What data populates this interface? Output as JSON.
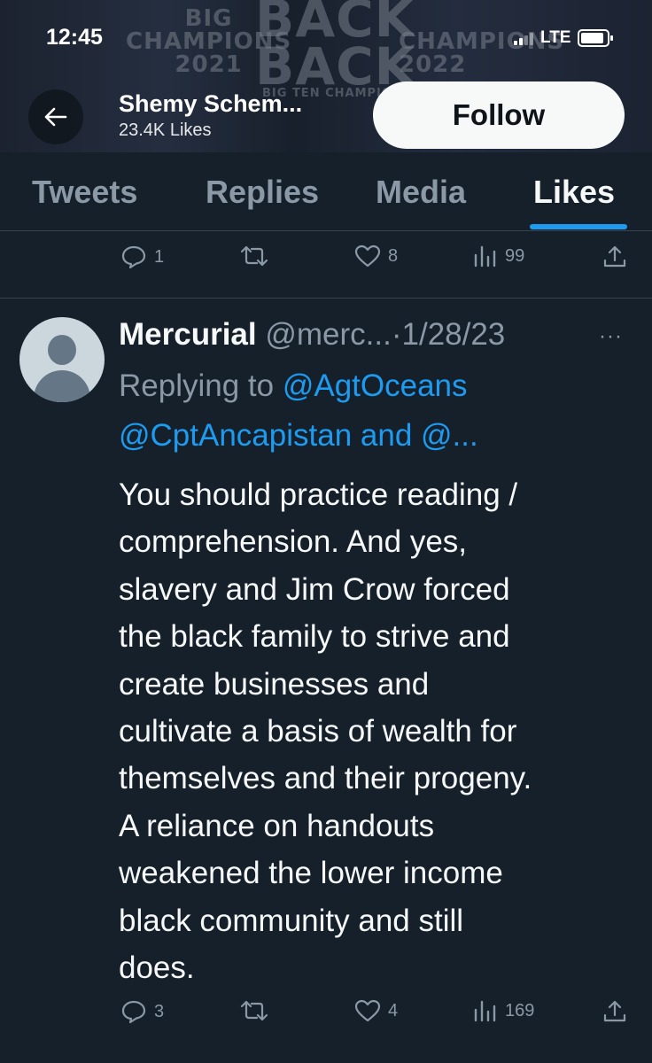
{
  "status": {
    "time": "12:45",
    "network": "LTE"
  },
  "header": {
    "banner_left": "BIG\nCHAMPIONS\n2021",
    "banner_mid": "BACK\nBACK",
    "banner_right": "CHAMPIONS\n2022",
    "banner_small": "BIG TEN CHAMPIONS",
    "name": "Shemy Schem...",
    "likes": "23.4K Likes",
    "follow_label": "Follow"
  },
  "tabs": [
    {
      "label": "Tweets"
    },
    {
      "label": "Replies"
    },
    {
      "label": "Media"
    },
    {
      "label": "Likes",
      "active": true
    }
  ],
  "prev_actions": {
    "replies": "1",
    "retweets": "",
    "likes": "8",
    "views": "99"
  },
  "tweet": {
    "author": "Mercurial",
    "handle": "@merc...",
    "sep": "·",
    "date": "1/28/23",
    "more": "···",
    "replying_prefix": "Replying to ",
    "mention1": "@AgtOceans",
    "mention2": "@CptAncapistan and @...",
    "lines": [
      "You should practice reading /",
      "comprehension. And yes,",
      "slavery and Jim Crow forced",
      "the black family to strive and",
      "create businesses and",
      "cultivate a basis of wealth for",
      "themselves and their progeny.",
      "A reliance on handouts",
      "weakened the lower income",
      "black community and still",
      "does."
    ],
    "actions": {
      "replies": "3",
      "retweets": "",
      "likes": "4",
      "views": "169"
    }
  },
  "colors": {
    "background": "#15202b",
    "accent": "#1d9bf0",
    "muted": "#8b98a5",
    "divider": "#38444d"
  }
}
